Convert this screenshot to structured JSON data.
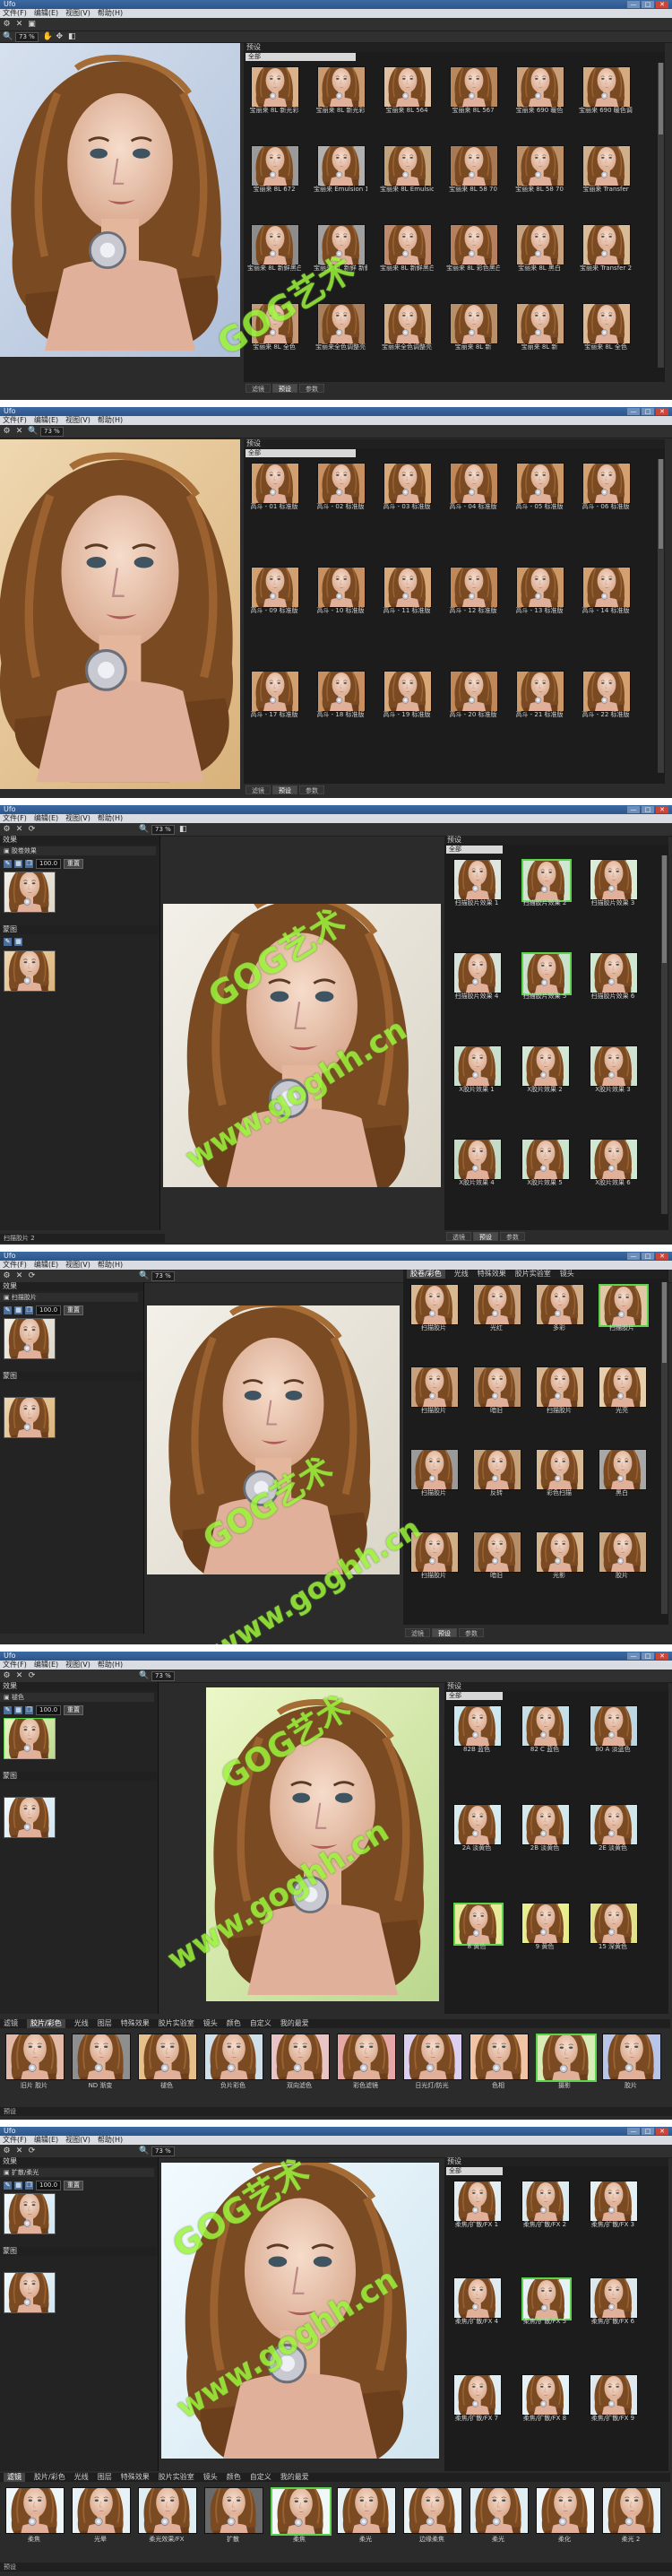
{
  "app": {
    "title": "Ufo",
    "window_controls": [
      "—",
      "□",
      "✕"
    ],
    "menu": [
      "文件(F)",
      "编辑(E)",
      "视图(V)",
      "帮助(H)"
    ],
    "zoom": "73 %",
    "dropdown_all": "全部",
    "panel_presets": "预设",
    "panel_effects": "效果",
    "panel_masks": "蒙图",
    "opacity": "100.0",
    "reset_label": "重置"
  },
  "watermark": {
    "top": "GOG艺术",
    "bottom": "www.goghh.cn"
  },
  "shots": [
    {
      "id": "s1",
      "tabs": [
        "滤镜",
        "预设",
        "参数"
      ],
      "active_tab": 1,
      "tiles": [
        "宝丽来 8L 新光彩",
        "宝丽来 8L 新光彩",
        "宝丽来 8L 564",
        "宝丽来 8L 567",
        "宝丽来 690 暖色",
        "宝丽来 690 暖色调整亮",
        "宝丽来 8L 672",
        "宝丽来 Emulsion 1",
        "宝丽来 8L Emulsion 2 冷",
        "宝丽来 8L 58 70",
        "宝丽来 8L 58 70",
        "宝丽来 Transfer",
        "宝丽来 8L 新鲜黑白",
        "宝丽来 8L 新鲜 新鲜",
        "宝丽来 8L 新鲜黑白",
        "宝丽来 8L 彩色黑白",
        "宝丽来 8L 黑白",
        "宝丽来 Transfer 2",
        "宝丽来 8L 全色",
        "宝丽来全色调整亮",
        "宝丽来全色调整亮",
        "宝丽来 8L 新",
        "宝丽来 8L 新",
        "宝丽来 8L 全色"
      ]
    },
    {
      "id": "s2",
      "tabs": [
        "滤镜",
        "预设",
        "参数"
      ],
      "active_tab": 1,
      "tiles": [
        "高斗 - 01 标准版",
        "高斗 - 02 标准版",
        "高斗 - 03 标准版",
        "高斗 - 04 标准版",
        "高斗 - 05 标准版",
        "高斗 - 06 标准版",
        "高斗 - 09 标准版",
        "高斗 - 10 标准版",
        "高斗 - 11 标准版",
        "高斗 - 12 标准版",
        "高斗 - 13 标准版",
        "高斗 - 14 标准版",
        "高斗 - 17 标准版",
        "高斗 - 18 标准版",
        "高斗 - 19 标准版",
        "高斗 - 20 标准版",
        "高斗 - 21 标准版",
        "高斗 - 22 标准版"
      ]
    },
    {
      "id": "s3",
      "effect_layer": "胶卷效果",
      "status": "扫描胶片 2",
      "tabs": [
        "透镜",
        "预设",
        "参数"
      ],
      "active_tab": 1,
      "tiles": [
        "扫描胶片效果 1",
        "扫描胶片效果 2",
        "扫描胶片效果 3",
        "扫描胶片效果 4",
        "扫描胶片效果 5",
        "扫描胶片效果 6",
        "X胶片效果 1",
        "X胶片效果 2",
        "X胶片效果 3",
        "X胶片效果 4",
        "X胶片效果 5",
        "X胶片效果 6"
      ]
    },
    {
      "id": "s4",
      "effect_layer": "扫描胶片",
      "cat_tabs": [
        "胶卷/彩色",
        "光线",
        "特殊效果",
        "胶片实验室",
        "镜头"
      ],
      "tabs": [
        "滤镜",
        "预设",
        "参数"
      ],
      "active_tab": 1,
      "tiles": [
        "扫描胶片",
        "光红",
        "多彩",
        "扫描胶片",
        "扫描胶片",
        "暗旧",
        "扫描胶片",
        "光亮",
        "扫描胶片",
        "反转",
        "彩色扫描",
        "黑白",
        "扫描胶片",
        "暗旧",
        "光影",
        "胶片"
      ]
    },
    {
      "id": "s5",
      "effect_layer": "褪色",
      "preset_tiles": [
        "82B 蓝色",
        "82 C 蓝色",
        "80 A 淡蓝色",
        "2A 淡黄色",
        "2B 淡黄色",
        "2E 淡黄色",
        "8 黄色",
        "9 黄色",
        "15 深黄色"
      ],
      "strip_tabs": [
        "滤镜",
        "胶片/彩色",
        "光线",
        "图层",
        "特殊效果",
        "胶片实验室",
        "镜头",
        "颜色",
        "自定义",
        "我的最爱"
      ],
      "strip_active": 1,
      "strip_tiles": [
        "旧片 胶片",
        "ND 渐变",
        "褪色",
        "负片彩色",
        "双向滤色",
        "彩色滤镜",
        "日光灯/防光",
        "色相",
        "摄影",
        "胶片"
      ],
      "strip_selected": 8,
      "bottom_label": "预设"
    },
    {
      "id": "s6",
      "effect_layer": "扩散/柔光",
      "preset_tiles": [
        "柔焦/扩散/FX 1",
        "柔焦/扩散/FX 2",
        "柔焦/扩散/FX 3",
        "柔焦/扩散/FX 4",
        "柔焦/扩散/FX 5",
        "柔焦/扩散/FX 6",
        "柔焦/扩散/FX 7",
        "柔焦/扩散/FX 8",
        "柔焦/扩散/FX 9"
      ],
      "strip_tabs": [
        "滤镜",
        "胶片/彩色",
        "光线",
        "图层",
        "特殊效果",
        "胶片实验室",
        "镜头",
        "颜色",
        "自定义",
        "我的最爱"
      ],
      "strip_active": 0,
      "strip_tiles": [
        "柔焦",
        "光晕",
        "柔光效果/FX",
        "扩散",
        "柔焦",
        "柔光",
        "边缘柔焦",
        "柔光",
        "柔化",
        "柔光 2"
      ],
      "strip_selected": 4,
      "bottom_label": "预设"
    }
  ]
}
